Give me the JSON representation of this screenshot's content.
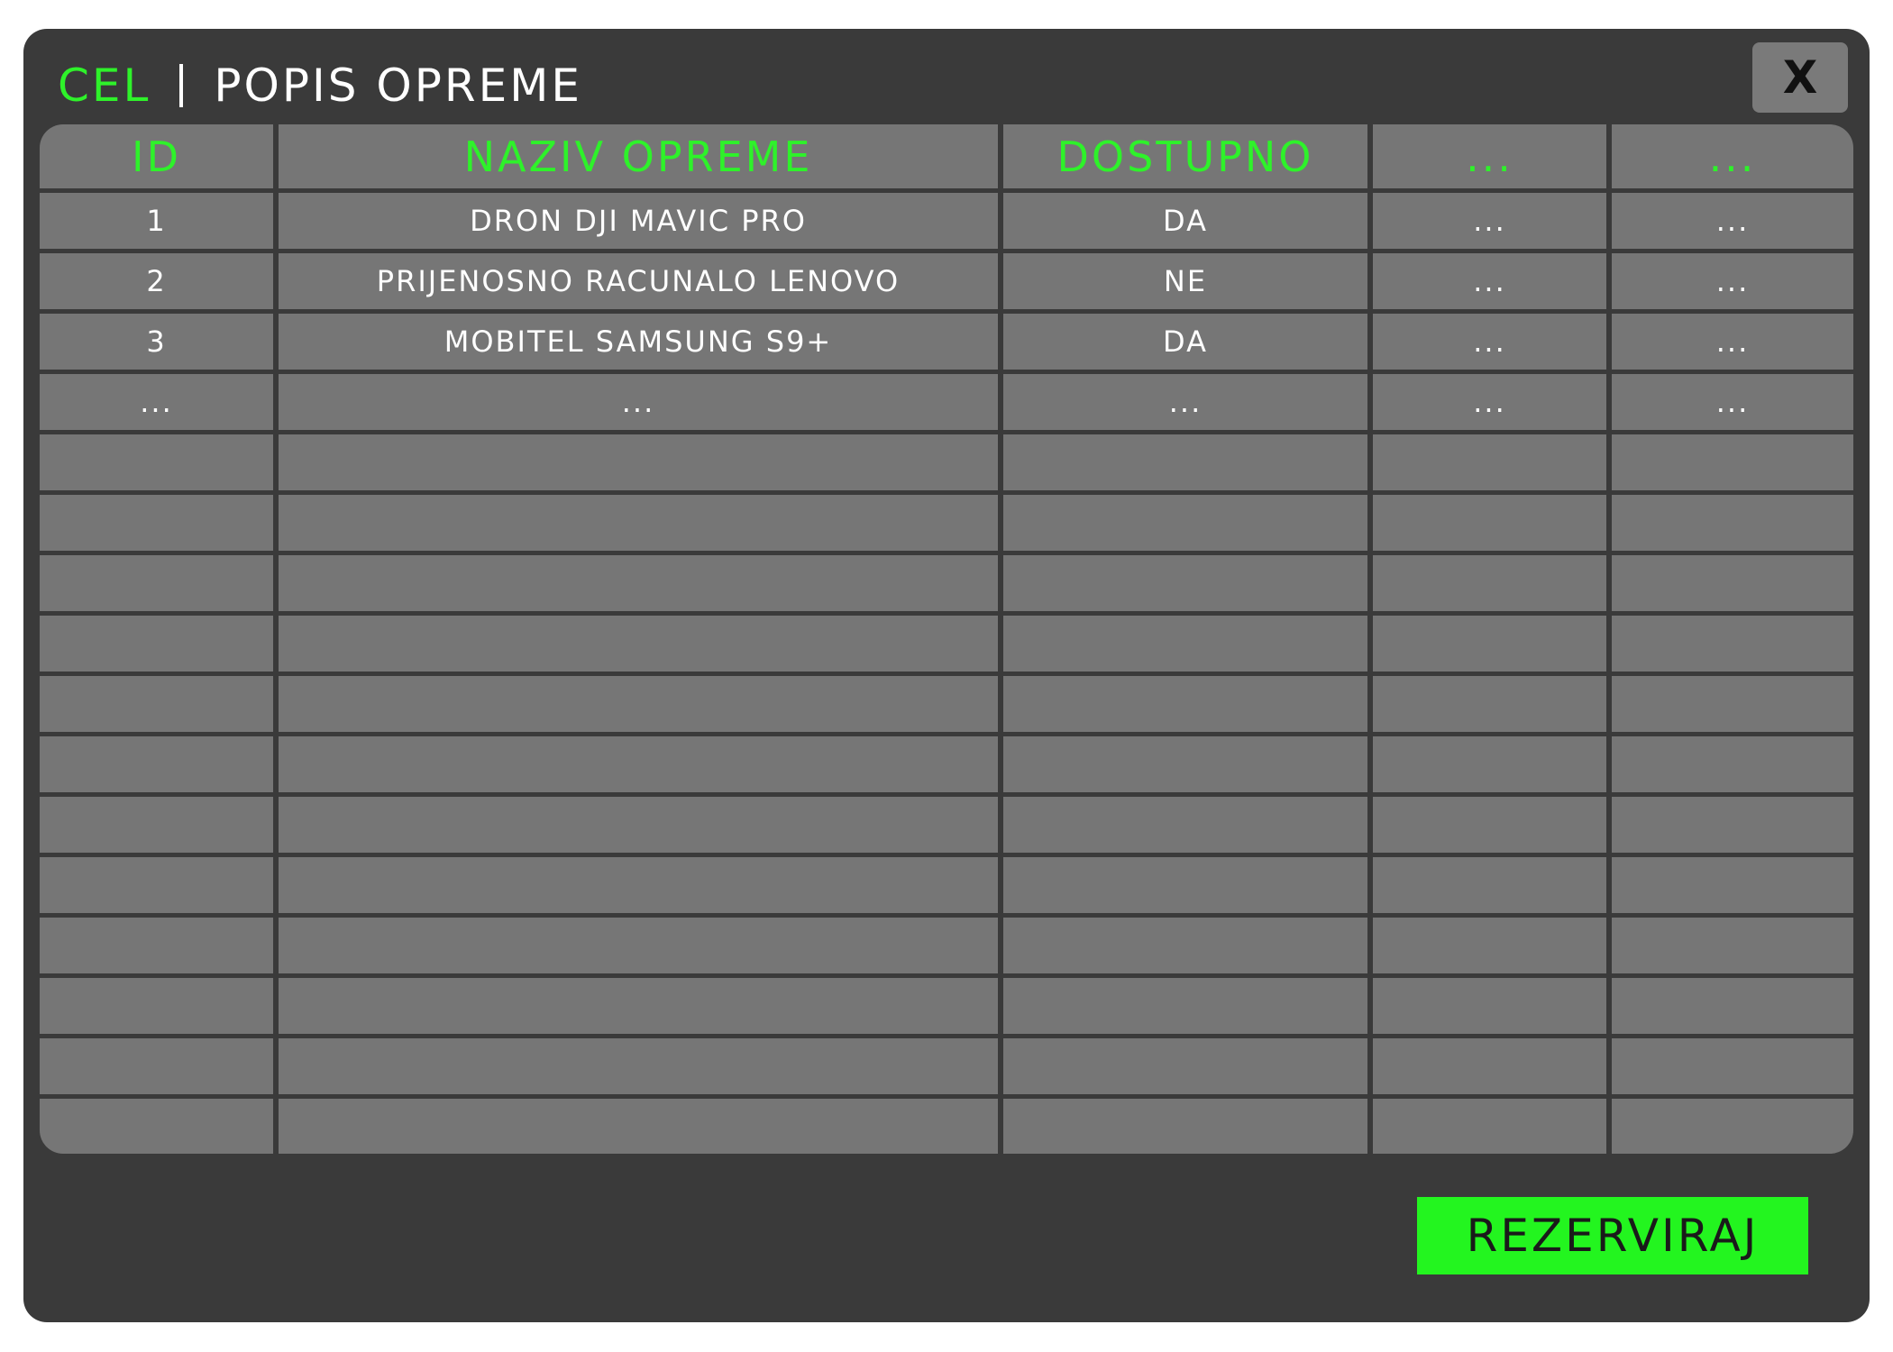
{
  "window": {
    "brand": "CEL",
    "title": "POPIS OPREME",
    "close_label": "X"
  },
  "table": {
    "columns": [
      "ID",
      "NAZIV OPREME",
      "DOSTUPNO",
      "...",
      "..."
    ],
    "rows": [
      [
        "1",
        "DRON DJI MAVIC PRO",
        "DA",
        "...",
        "..."
      ],
      [
        "2",
        "PRIJENOSNO RACUNALO LENOVO",
        "NE",
        "...",
        "..."
      ],
      [
        "3",
        "MOBITEL SAMSUNG S9+",
        "DA",
        "...",
        "..."
      ],
      [
        "...",
        "...",
        "...",
        "...",
        "..."
      ]
    ],
    "empty_row_count": 12
  },
  "actions": {
    "reserve_label": "REZERVIRAJ"
  },
  "colors": {
    "accent": "#2ef22a",
    "window_bg": "#3a3a3a",
    "cell_bg": "#767676",
    "button_bg": "#23f51f"
  }
}
